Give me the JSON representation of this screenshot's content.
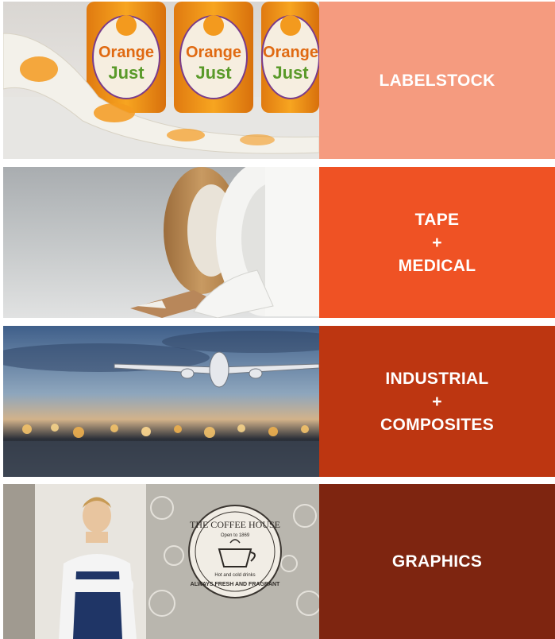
{
  "tiles": [
    {
      "id": "labelstock",
      "label_lines": [
        "LABELSTOCK"
      ],
      "color": "#f59b7f",
      "image_name": "orange-juice-bottles-label-rolls",
      "image_text": {
        "bottle_brand_top": "Orange",
        "bottle_brand_bottom": "Just"
      }
    },
    {
      "id": "tape-medical",
      "label_lines": [
        "TAPE",
        "+",
        "MEDICAL"
      ],
      "color": "#ef5224",
      "image_name": "tape-rolls-with-liner"
    },
    {
      "id": "industrial-composites",
      "label_lines": [
        "INDUSTRIAL",
        "+",
        "COMPOSITES"
      ],
      "color": "#bd3611",
      "image_name": "airplane-over-city-lights"
    },
    {
      "id": "graphics",
      "label_lines": [
        "GRAPHICS"
      ],
      "color": "#7e2510",
      "image_name": "barista-with-coffee-house-window-graphic",
      "image_text": {
        "sign_title": "THE COFFEE HOUSE",
        "sign_since": "Open to 1869",
        "sign_sub": "Hot and cold drinks",
        "sign_tagline": "ALWAYS FRESH AND FRAGRANT"
      }
    }
  ]
}
